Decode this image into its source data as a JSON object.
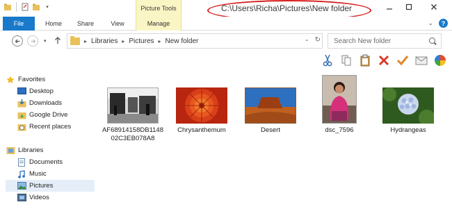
{
  "window": {
    "title": "C:\\Users\\Richa\\Pictures\\New folder"
  },
  "context_tab": {
    "header": "Picture Tools"
  },
  "ribbon": {
    "tabs": [
      {
        "label": "File"
      },
      {
        "label": "Home"
      },
      {
        "label": "Share"
      },
      {
        "label": "View"
      },
      {
        "label": "Manage"
      }
    ]
  },
  "address": {
    "breadcrumb": [
      "Libraries",
      "Pictures",
      "New folder"
    ]
  },
  "search": {
    "placeholder": "Search New folder"
  },
  "nav": {
    "favorites": "Favorites",
    "favorites_items": [
      "Desktop",
      "Downloads",
      "Google Drive",
      "Recent places"
    ],
    "libraries": "Libraries",
    "libraries_items": [
      "Documents",
      "Music",
      "Pictures",
      "Videos"
    ],
    "selected": "Pictures"
  },
  "files": [
    {
      "name": "AF68914158DB114802C3EB078A8",
      "kind": "bw-photo"
    },
    {
      "name": "Chrysanthemum",
      "kind": "chrysanthemum"
    },
    {
      "name": "Desert",
      "kind": "desert"
    },
    {
      "name": "dsc_7596",
      "kind": "portrait"
    },
    {
      "name": "Hydrangeas",
      "kind": "hydrangeas"
    }
  ],
  "colors": {
    "accent": "#1979ca",
    "context_tab": "#faf5c4",
    "annotation": "#d81e1e",
    "selection": "#e5eef8"
  },
  "icons": [
    "cut-icon",
    "copy-icon",
    "paste-icon",
    "delete-icon",
    "checkmark-icon",
    "email-icon",
    "color-wheel-icon"
  ]
}
